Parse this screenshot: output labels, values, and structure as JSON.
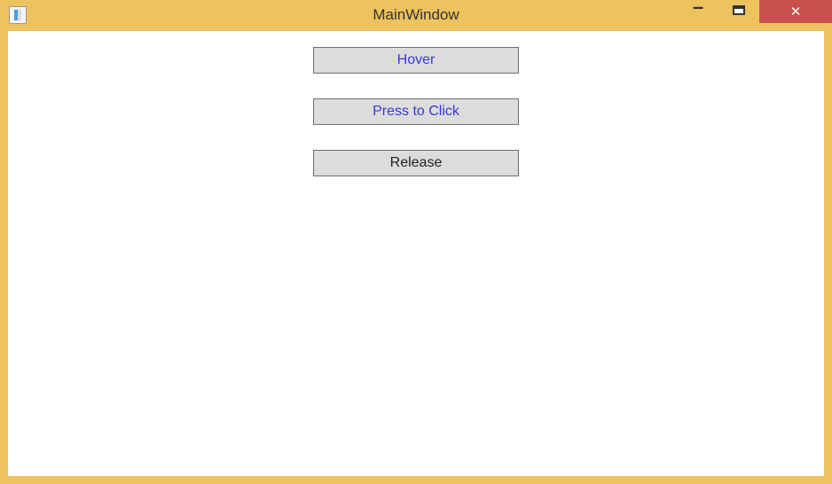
{
  "window": {
    "title": "MainWindow"
  },
  "buttons": {
    "hover": "Hover",
    "press": "Press to Click",
    "release": "Release"
  },
  "controls": {
    "minimize": "—",
    "close": "✕"
  }
}
